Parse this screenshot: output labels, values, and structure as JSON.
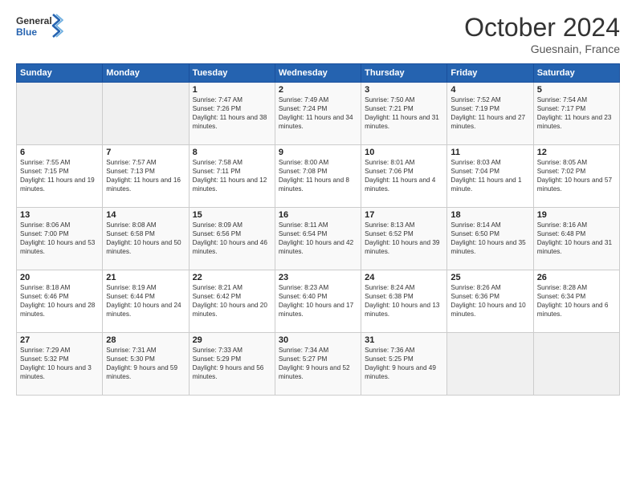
{
  "logo": {
    "text1": "General",
    "text2": "Blue"
  },
  "title": "October 2024",
  "location": "Guesnain, France",
  "header_days": [
    "Sunday",
    "Monday",
    "Tuesday",
    "Wednesday",
    "Thursday",
    "Friday",
    "Saturday"
  ],
  "weeks": [
    [
      {
        "num": "",
        "sunrise": "",
        "sunset": "",
        "daylight": ""
      },
      {
        "num": "",
        "sunrise": "",
        "sunset": "",
        "daylight": ""
      },
      {
        "num": "1",
        "sunrise": "Sunrise: 7:47 AM",
        "sunset": "Sunset: 7:26 PM",
        "daylight": "Daylight: 11 hours and 38 minutes."
      },
      {
        "num": "2",
        "sunrise": "Sunrise: 7:49 AM",
        "sunset": "Sunset: 7:24 PM",
        "daylight": "Daylight: 11 hours and 34 minutes."
      },
      {
        "num": "3",
        "sunrise": "Sunrise: 7:50 AM",
        "sunset": "Sunset: 7:21 PM",
        "daylight": "Daylight: 11 hours and 31 minutes."
      },
      {
        "num": "4",
        "sunrise": "Sunrise: 7:52 AM",
        "sunset": "Sunset: 7:19 PM",
        "daylight": "Daylight: 11 hours and 27 minutes."
      },
      {
        "num": "5",
        "sunrise": "Sunrise: 7:54 AM",
        "sunset": "Sunset: 7:17 PM",
        "daylight": "Daylight: 11 hours and 23 minutes."
      }
    ],
    [
      {
        "num": "6",
        "sunrise": "Sunrise: 7:55 AM",
        "sunset": "Sunset: 7:15 PM",
        "daylight": "Daylight: 11 hours and 19 minutes."
      },
      {
        "num": "7",
        "sunrise": "Sunrise: 7:57 AM",
        "sunset": "Sunset: 7:13 PM",
        "daylight": "Daylight: 11 hours and 16 minutes."
      },
      {
        "num": "8",
        "sunrise": "Sunrise: 7:58 AM",
        "sunset": "Sunset: 7:11 PM",
        "daylight": "Daylight: 11 hours and 12 minutes."
      },
      {
        "num": "9",
        "sunrise": "Sunrise: 8:00 AM",
        "sunset": "Sunset: 7:08 PM",
        "daylight": "Daylight: 11 hours and 8 minutes."
      },
      {
        "num": "10",
        "sunrise": "Sunrise: 8:01 AM",
        "sunset": "Sunset: 7:06 PM",
        "daylight": "Daylight: 11 hours and 4 minutes."
      },
      {
        "num": "11",
        "sunrise": "Sunrise: 8:03 AM",
        "sunset": "Sunset: 7:04 PM",
        "daylight": "Daylight: 11 hours and 1 minute."
      },
      {
        "num": "12",
        "sunrise": "Sunrise: 8:05 AM",
        "sunset": "Sunset: 7:02 PM",
        "daylight": "Daylight: 10 hours and 57 minutes."
      }
    ],
    [
      {
        "num": "13",
        "sunrise": "Sunrise: 8:06 AM",
        "sunset": "Sunset: 7:00 PM",
        "daylight": "Daylight: 10 hours and 53 minutes."
      },
      {
        "num": "14",
        "sunrise": "Sunrise: 8:08 AM",
        "sunset": "Sunset: 6:58 PM",
        "daylight": "Daylight: 10 hours and 50 minutes."
      },
      {
        "num": "15",
        "sunrise": "Sunrise: 8:09 AM",
        "sunset": "Sunset: 6:56 PM",
        "daylight": "Daylight: 10 hours and 46 minutes."
      },
      {
        "num": "16",
        "sunrise": "Sunrise: 8:11 AM",
        "sunset": "Sunset: 6:54 PM",
        "daylight": "Daylight: 10 hours and 42 minutes."
      },
      {
        "num": "17",
        "sunrise": "Sunrise: 8:13 AM",
        "sunset": "Sunset: 6:52 PM",
        "daylight": "Daylight: 10 hours and 39 minutes."
      },
      {
        "num": "18",
        "sunrise": "Sunrise: 8:14 AM",
        "sunset": "Sunset: 6:50 PM",
        "daylight": "Daylight: 10 hours and 35 minutes."
      },
      {
        "num": "19",
        "sunrise": "Sunrise: 8:16 AM",
        "sunset": "Sunset: 6:48 PM",
        "daylight": "Daylight: 10 hours and 31 minutes."
      }
    ],
    [
      {
        "num": "20",
        "sunrise": "Sunrise: 8:18 AM",
        "sunset": "Sunset: 6:46 PM",
        "daylight": "Daylight: 10 hours and 28 minutes."
      },
      {
        "num": "21",
        "sunrise": "Sunrise: 8:19 AM",
        "sunset": "Sunset: 6:44 PM",
        "daylight": "Daylight: 10 hours and 24 minutes."
      },
      {
        "num": "22",
        "sunrise": "Sunrise: 8:21 AM",
        "sunset": "Sunset: 6:42 PM",
        "daylight": "Daylight: 10 hours and 20 minutes."
      },
      {
        "num": "23",
        "sunrise": "Sunrise: 8:23 AM",
        "sunset": "Sunset: 6:40 PM",
        "daylight": "Daylight: 10 hours and 17 minutes."
      },
      {
        "num": "24",
        "sunrise": "Sunrise: 8:24 AM",
        "sunset": "Sunset: 6:38 PM",
        "daylight": "Daylight: 10 hours and 13 minutes."
      },
      {
        "num": "25",
        "sunrise": "Sunrise: 8:26 AM",
        "sunset": "Sunset: 6:36 PM",
        "daylight": "Daylight: 10 hours and 10 minutes."
      },
      {
        "num": "26",
        "sunrise": "Sunrise: 8:28 AM",
        "sunset": "Sunset: 6:34 PM",
        "daylight": "Daylight: 10 hours and 6 minutes."
      }
    ],
    [
      {
        "num": "27",
        "sunrise": "Sunrise: 7:29 AM",
        "sunset": "Sunset: 5:32 PM",
        "daylight": "Daylight: 10 hours and 3 minutes."
      },
      {
        "num": "28",
        "sunrise": "Sunrise: 7:31 AM",
        "sunset": "Sunset: 5:30 PM",
        "daylight": "Daylight: 9 hours and 59 minutes."
      },
      {
        "num": "29",
        "sunrise": "Sunrise: 7:33 AM",
        "sunset": "Sunset: 5:29 PM",
        "daylight": "Daylight: 9 hours and 56 minutes."
      },
      {
        "num": "30",
        "sunrise": "Sunrise: 7:34 AM",
        "sunset": "Sunset: 5:27 PM",
        "daylight": "Daylight: 9 hours and 52 minutes."
      },
      {
        "num": "31",
        "sunrise": "Sunrise: 7:36 AM",
        "sunset": "Sunset: 5:25 PM",
        "daylight": "Daylight: 9 hours and 49 minutes."
      },
      {
        "num": "",
        "sunrise": "",
        "sunset": "",
        "daylight": ""
      },
      {
        "num": "",
        "sunrise": "",
        "sunset": "",
        "daylight": ""
      }
    ]
  ]
}
